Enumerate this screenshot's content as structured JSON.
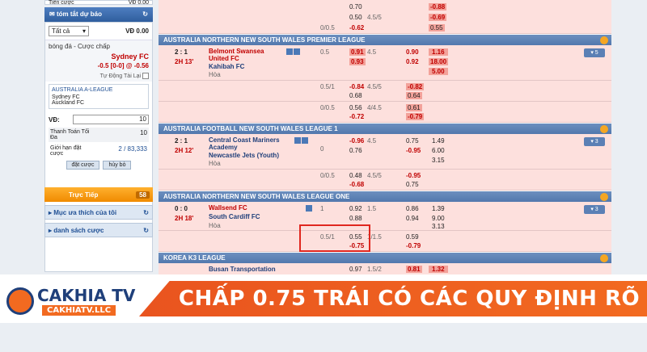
{
  "left": {
    "top_label": "Tiền cược",
    "top_value": "VĐ 0.00",
    "notify_title": "tóm tắt dự báo",
    "select_all": "Tất cả",
    "vd_value": "VĐ 0.00",
    "bet_type": "bóng đá - Cược chấp",
    "team": "Sydney FC",
    "line": "-0.5 [0-0] @",
    "price": "-0.56",
    "auto_accept": "Tự Động Tài Lại",
    "league": "AUSTRALIA A-LEAGUE",
    "home": "Sydney FC",
    "away": "Auckland FC",
    "vd_label": "VĐ:",
    "vd_input": "10",
    "pay_label": "Thanh Toán Tối Đa",
    "pay_value": "10",
    "limit_label": "Giới hạn đặt cược",
    "limit_value": "2 / 83,333",
    "btn_place": "đặt cược",
    "btn_cancel": "hủy bỏ",
    "live_label": "Trực Tiếp",
    "live_count": "58",
    "fav_label": "Mục ưa thích của tôi",
    "list_label": "danh sách cược"
  },
  "top_rows": [
    {
      "a": "",
      "b": "0.70",
      "c": "",
      "d": "-0.88"
    },
    {
      "a": "",
      "b": "0.50",
      "c": "4.5/5",
      "d": "-0.69"
    },
    {
      "a": "0/0.5",
      "b": "-0.62",
      "c": "",
      "d": "0.55"
    }
  ],
  "leagues": [
    {
      "name": "AUSTRALIA NORTHERN NEW SOUTH WALES PREMIER LEAGUE",
      "score": "2 : 1",
      "time": "2H 13'",
      "home": "Belmont Swansea United FC",
      "away": "Kahibah FC",
      "draw": "Hòa",
      "hdp": "0.5",
      "h1": "0.91",
      "ou": "4.5",
      "h2": "0.93",
      "o1": "0.90",
      "o2": "0.92",
      "x1": "1.16",
      "x2": "18.00",
      "x3": "5.00",
      "more": "5",
      "subs": [
        {
          "hdp": "0.5/1",
          "a": "-0.84",
          "b": "0.68",
          "ou": "4.5/5",
          "o1": "-0.82",
          "o2": "0.64"
        },
        {
          "hdp": "0/0.5",
          "a": "0.56",
          "b": "-0.72",
          "ou": "4/4.5",
          "o1": "0.61",
          "o2": "-0.79"
        }
      ]
    },
    {
      "name": "AUSTRALIA FOOTBALL NEW SOUTH WALES LEAGUE 1",
      "score": "2 : 1",
      "time": "2H 12'",
      "home": "Central Coast Mariners Academy",
      "away": "Newcastle Jets (Youth)",
      "draw": "Hòa",
      "hdp": "0",
      "h1": "-0.96",
      "ou": "4.5",
      "h2": "0.76",
      "o1": "0.75",
      "o2": "-0.95",
      "x1": "1.49",
      "x2": "6.00",
      "x3": "3.15",
      "more": "3",
      "subs": [
        {
          "hdp": "0/0.5",
          "a": "0.48",
          "b": "-0.68",
          "ou": "4.5/5",
          "o1": "-0.95",
          "o2": "0.75"
        }
      ]
    },
    {
      "name": "AUSTRALIA NORTHERN NEW SOUTH WALES LEAGUE ONE",
      "score": "0 : 0",
      "time": "2H 18'",
      "home": "Wallsend FC",
      "away": "South Cardiff FC",
      "draw": "Hòa",
      "hdp": "1",
      "h1": "0.92",
      "ou": "1.5",
      "h2": "0.88",
      "o1": "0.86",
      "o2": "0.94",
      "x1": "1.39",
      "x2": "9.00",
      "x3": "3.13",
      "more": "3",
      "subs": [
        {
          "hdp": "0.5/1",
          "a": "0.55",
          "b": "-0.75",
          "ou": "1/1.5",
          "o1": "0.59",
          "o2": "-0.79"
        }
      ]
    }
  ],
  "last_league": "KOREA K3 LEAGUE",
  "last_team": "Busan Transportation",
  "last_vals": {
    "a": "0.97",
    "b": "1.5/2",
    "c": "0.81",
    "d": "1.32"
  },
  "banner": {
    "text": "CHẤP 0.75 TRÁI CÓ CÁC QUY ĐỊNH RÕ RÀNG",
    "logo": "CAKHIA TV",
    "logo_sub": "CAKHIATV.LLC"
  }
}
